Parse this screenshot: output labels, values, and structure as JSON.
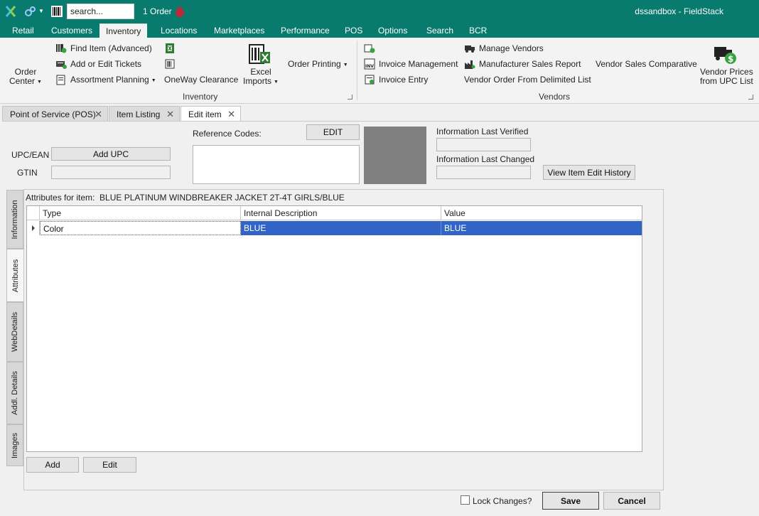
{
  "titlebar": {
    "search_placeholder": "search...",
    "order_count": "1 Order",
    "app_title": "dssandbox - FieldStack",
    "icons": [
      "logo-icon",
      "link-icon",
      "barcode-icon",
      "cart-icon"
    ]
  },
  "menu": {
    "items": [
      "Retail",
      "Customers",
      "Inventory",
      "Locations",
      "Marketplaces",
      "Performance",
      "POS",
      "Options",
      "Search",
      "BCR"
    ],
    "active": "Inventory"
  },
  "ribbon": {
    "order_center": [
      "Order",
      "Center"
    ],
    "find_item": "Find Item (Advanced)",
    "add_edit_tickets": "Add or Edit Tickets",
    "assortment_planning": "Assortment Planning",
    "oneway_clearance": "OneWay Clearance",
    "excel_imports": [
      "Excel",
      "Imports"
    ],
    "order_printing": "Order Printing",
    "inventory_group": "Inventory",
    "invoice_management": "Invoice Management",
    "invoice_entry": "Invoice Entry",
    "manage_vendors": "Manage Vendors",
    "manufacturer_sales_report": "Manufacturer Sales Report",
    "vendor_order_from_list": "Vendor Order From Delimited List",
    "vendor_sales_comparative": "Vendor Sales Comparative",
    "vendor_prices": [
      "Vendor Prices",
      "from UPC List"
    ],
    "vendors_group": "Vendors"
  },
  "doc_tabs": [
    {
      "label": "Point of Service (POS)",
      "active": false
    },
    {
      "label": "Item Listing",
      "active": false
    },
    {
      "label": "Edit item",
      "active": true
    }
  ],
  "edit_item": {
    "upc_label": "UPC/EAN",
    "add_upc": "Add UPC",
    "gtin_label": "GTIN",
    "gtin_value": "",
    "reference_codes_label": "Reference Codes:",
    "edit_button": "EDIT",
    "info_last_verified_label": "Information Last Verified",
    "info_last_verified_value": "",
    "info_last_changed_label": "Information Last Changed",
    "info_last_changed_value": "",
    "view_history_button": "View Item Edit History"
  },
  "side_tabs": [
    "Information",
    "Attributes",
    "WebDetails",
    "Addl. Details",
    "Images"
  ],
  "active_side_tab": "Attributes",
  "attributes": {
    "caption": "Attributes for item:  BLUE PLATINUM WINDBREAKER JACKET 2T-4T GIRLS/BLUE",
    "columns": [
      "Type",
      "Internal Description",
      "Value"
    ],
    "rows": [
      {
        "type": "Color",
        "internal_description": "BLUE",
        "value": "BLUE",
        "selected": true
      }
    ],
    "add_button": "Add",
    "edit_button": "Edit"
  },
  "footer": {
    "lock_changes_label": "Lock Changes?",
    "lock_changes_checked": false,
    "save_button": "Save",
    "cancel_button": "Cancel"
  },
  "colors": {
    "header_teal": "#087a6e",
    "selection_blue": "#3264c8",
    "image_placeholder": "#808080"
  }
}
